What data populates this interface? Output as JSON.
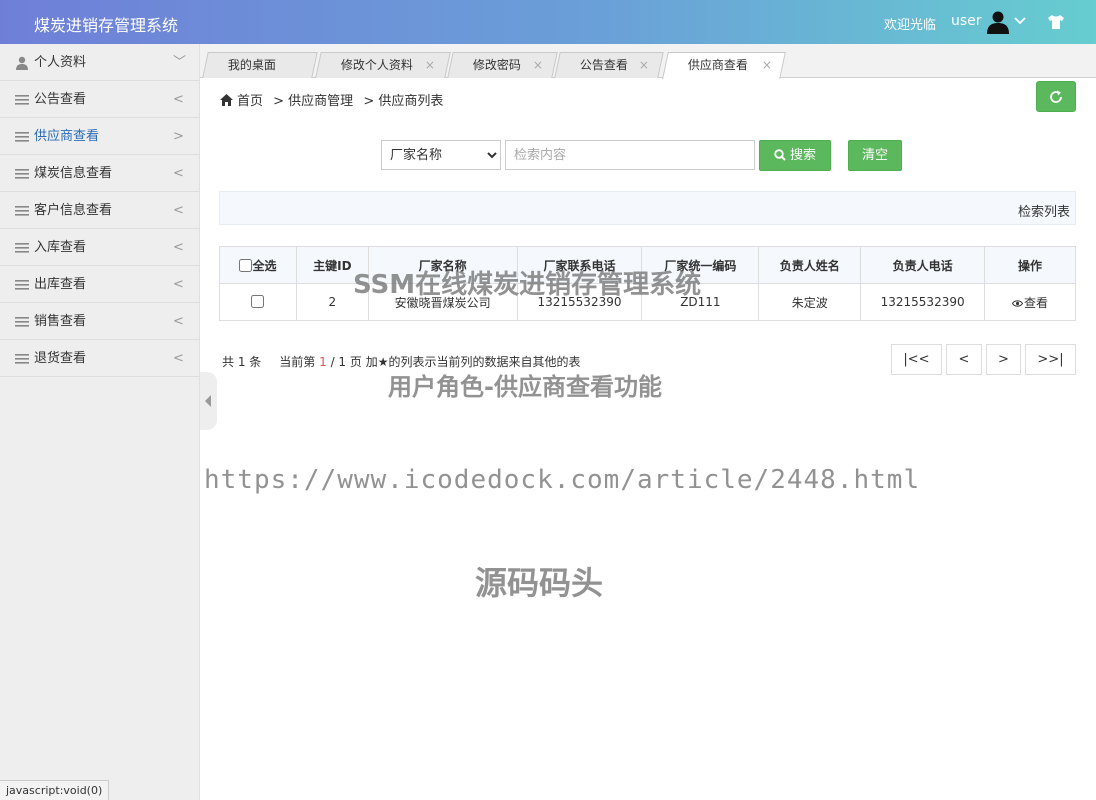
{
  "header": {
    "app_title": "煤炭进销存管理系统",
    "welcome": "欢迎光临",
    "username": "user"
  },
  "sidebar": {
    "items": [
      {
        "label": "个人资料",
        "arrow": "﹀",
        "icon": "user-icon"
      },
      {
        "label": "公告查看",
        "arrow": "<",
        "icon": "menu-icon"
      },
      {
        "label": "供应商查看",
        "arrow": ">",
        "icon": "menu-icon"
      },
      {
        "label": "煤炭信息查看",
        "arrow": "<",
        "icon": "menu-icon"
      },
      {
        "label": "客户信息查看",
        "arrow": "<",
        "icon": "menu-icon"
      },
      {
        "label": "入库查看",
        "arrow": "<",
        "icon": "menu-icon"
      },
      {
        "label": "出库查看",
        "arrow": "<",
        "icon": "menu-icon"
      },
      {
        "label": "销售查看",
        "arrow": "<",
        "icon": "menu-icon"
      },
      {
        "label": "退货查看",
        "arrow": "<",
        "icon": "menu-icon"
      }
    ]
  },
  "tabs": [
    {
      "label": "我的桌面"
    },
    {
      "label": "修改个人资料",
      "close": "×"
    },
    {
      "label": "修改密码",
      "close": "×"
    },
    {
      "label": "公告查看",
      "close": "×"
    },
    {
      "label": "供应商查看",
      "close": "×"
    }
  ],
  "breadcrumb": {
    "home": "首页",
    "level1": "> 供应商管理",
    "level2": "> 供应商列表"
  },
  "search": {
    "field_selected": "厂家名称",
    "placeholder": "检索内容",
    "search_label": "搜索",
    "clear_label": "清空"
  },
  "panel": {
    "title": "检索列表"
  },
  "table": {
    "select_all": "全选",
    "headers": [
      "主键ID",
      "厂家名称",
      "厂家联系电话",
      "厂家统一编码",
      "负责人姓名",
      "负责人电话",
      "操作"
    ],
    "rows": [
      {
        "id": "2",
        "name": "安徽晓晋煤炭公司",
        "phone": "13215532390",
        "code": "ZD111",
        "manager": "朱定波",
        "manager_phone": "13215532390",
        "action": "查看"
      }
    ]
  },
  "pager": {
    "total": "共 1 条",
    "current_prefix": "当前第",
    "current_page": "1",
    "current_suffix": "/ 1 页",
    "note": "加★的列表示当前列的数据来自其他的表",
    "first": "|<<",
    "prev": "<",
    "next": ">",
    "last": ">>|"
  },
  "statusbar": "javascript:void(0)",
  "watermarks": {
    "line1": "SSM在线煤炭进销存管理系统",
    "line2": "用户角色-供应商查看功能",
    "line3": "https://www.icodedock.com/article/2448.html",
    "line4": "源码码头"
  },
  "colors": {
    "accent_green": "#5cb85c",
    "active_link": "#2a6bb3",
    "header_gradient_start": "#6f7fd8",
    "header_gradient_end": "#66cdd0"
  }
}
